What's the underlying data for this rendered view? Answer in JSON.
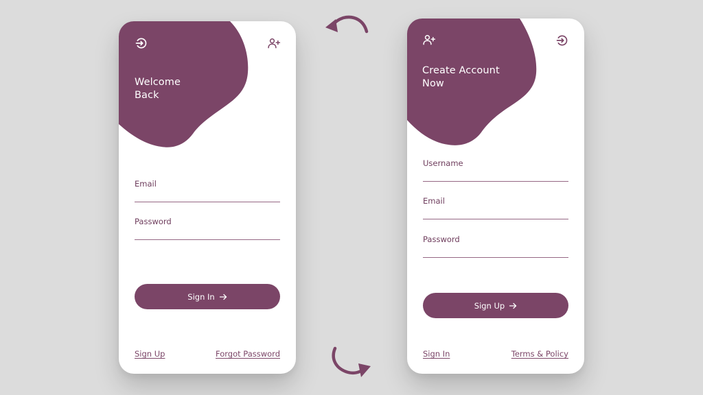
{
  "colors": {
    "background": "#dcdcdc",
    "accent": "#7b4567",
    "card": "#ffffff",
    "label": "#6e3c5c"
  },
  "login": {
    "top_left_icon": "sign-in-icon",
    "top_right_icon": "add-user-icon",
    "title_line1": "Welcome",
    "title_line2": "Back",
    "email_label": "Email",
    "password_label": "Password",
    "submit_label": "Sign In",
    "footer_left": "Sign Up",
    "footer_right": "Forgot Password"
  },
  "signup": {
    "top_left_icon": "add-user-icon",
    "top_right_icon": "sign-in-icon",
    "title_line1": "Create Account",
    "title_line2": "Now",
    "username_label": "Username",
    "email_label": "Email",
    "password_label": "Password",
    "submit_label": "Sign Up",
    "footer_left": "Sign In",
    "footer_right": "Terms & Policy"
  },
  "decor": {
    "top_arrow_icon": "curved-arrow-left-icon",
    "bottom_arrow_icon": "curved-arrow-right-icon"
  }
}
